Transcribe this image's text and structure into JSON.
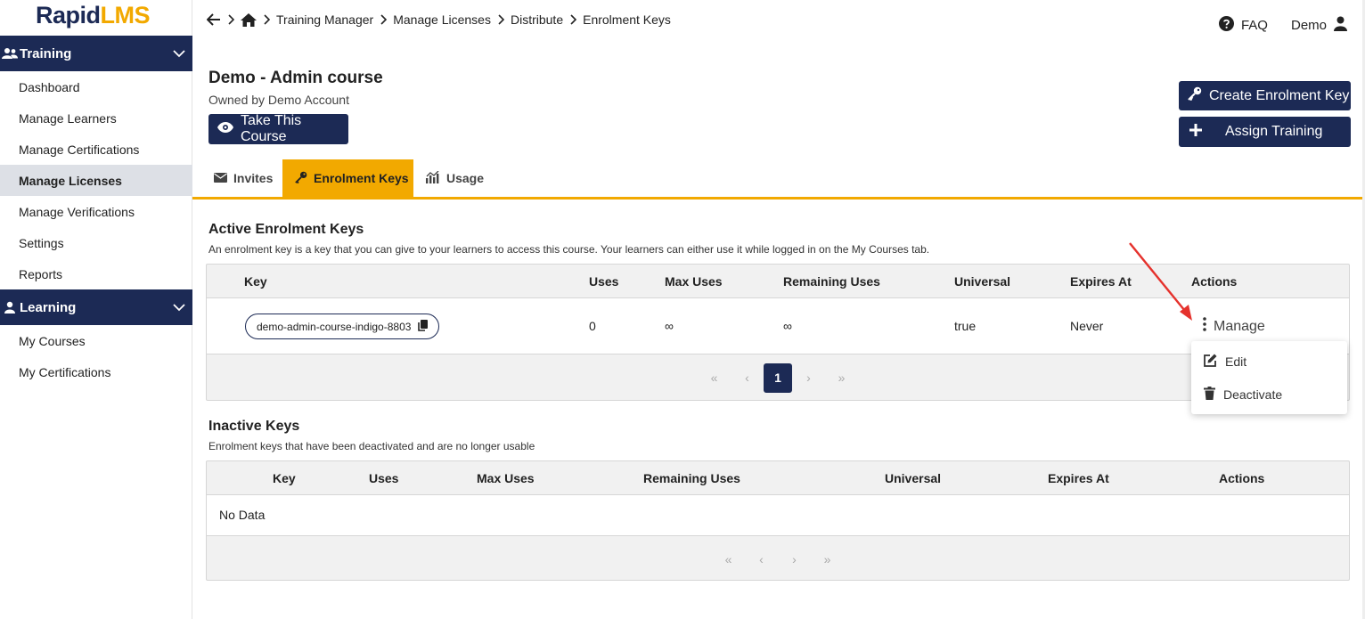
{
  "brand": {
    "part1": "Rapid",
    "part2": "LMS"
  },
  "sidebar": {
    "training": {
      "label": "Training",
      "items": [
        "Dashboard",
        "Manage Learners",
        "Manage Certifications",
        "Manage Licenses",
        "Manage Verifications",
        "Settings",
        "Reports"
      ]
    },
    "learning": {
      "label": "Learning",
      "items": [
        "My Courses",
        "My Certifications"
      ]
    }
  },
  "breadcrumb": [
    "Training Manager",
    "Manage Licenses",
    "Distribute",
    "Enrolment Keys"
  ],
  "topbar": {
    "faq": "FAQ",
    "user": "Demo"
  },
  "course": {
    "title": "Demo - Admin course",
    "owner": "Owned by Demo Account",
    "take_label": "Take This Course"
  },
  "actions": {
    "create_key": "Create Enrolment Key",
    "assign": "Assign Training"
  },
  "tabs": [
    "Invites",
    "Enrolment Keys",
    "Usage"
  ],
  "active": {
    "title": "Active Enrolment Keys",
    "description": "An enrolment key is a key that you can give to your learners to access this course. Your learners can either use it while logged in on the My Courses tab.",
    "columns": [
      "Key",
      "Uses",
      "Max Uses",
      "Remaining Uses",
      "Universal",
      "Expires At",
      "Actions"
    ],
    "row": {
      "key": "demo-admin-course-indigo-8803",
      "uses": "0",
      "max_uses": "∞",
      "remaining": "∞",
      "universal": "true",
      "expires": "Never",
      "action": "Manage"
    },
    "page": "1"
  },
  "menu": {
    "edit": "Edit",
    "deactivate": "Deactivate"
  },
  "inactive": {
    "title": "Inactive Keys",
    "description": "Enrolment keys that have been deactivated and are no longer usable",
    "columns": [
      "Key",
      "Uses",
      "Max Uses",
      "Remaining Uses",
      "Universal",
      "Expires At",
      "Actions"
    ],
    "empty": "No Data"
  },
  "pager_symbols": {
    "first": "«",
    "prev": "‹",
    "next": "›",
    "last": "»"
  },
  "colors": {
    "navy": "#1c2a55",
    "accent": "#f2a900",
    "annotation": "#e5322d"
  }
}
